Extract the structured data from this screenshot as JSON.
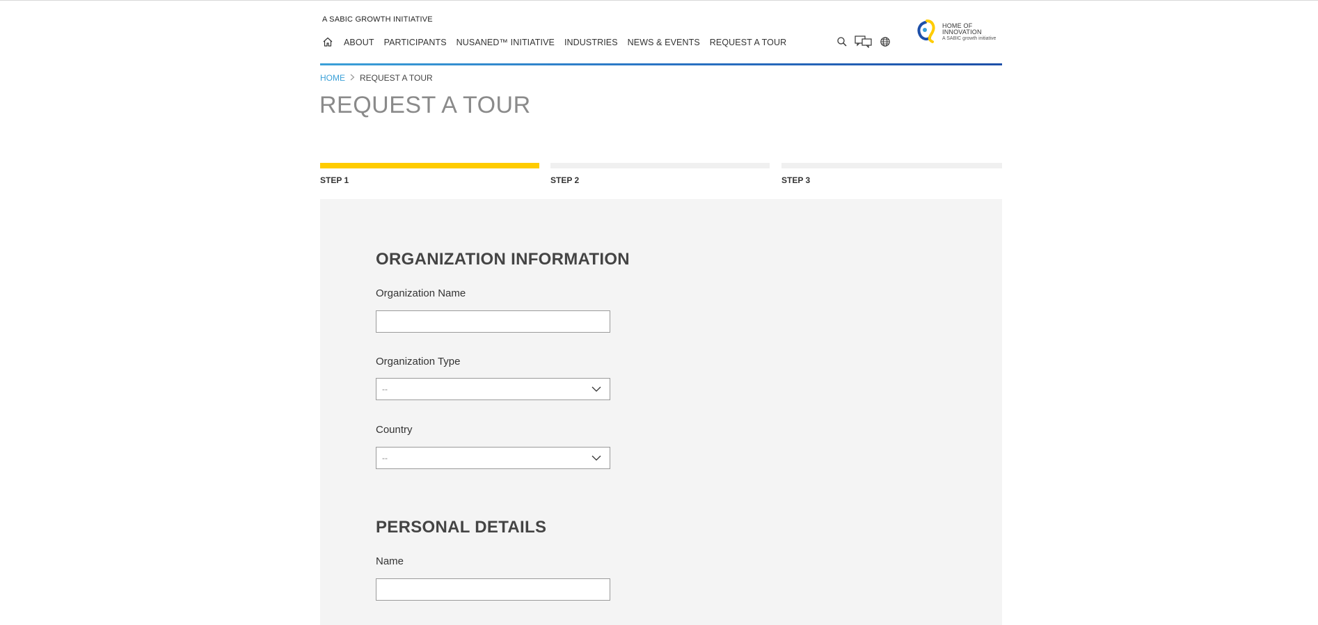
{
  "header": {
    "tagline": "A SABIC GROWTH INITIATIVE",
    "nav": [
      {
        "label": "ABOUT"
      },
      {
        "label": "PARTICIPANTS"
      },
      {
        "label": "NUSANED™ INITIATIVE"
      },
      {
        "label": "INDUSTRIES"
      },
      {
        "label": "NEWS & EVENTS"
      },
      {
        "label": "REQUEST A TOUR"
      }
    ],
    "icons": [
      "home-icon",
      "search-icon",
      "chat-icon",
      "globe-icon"
    ],
    "logo": {
      "line1": "HOME OF",
      "line2": "INNOVATION",
      "line3": "A SABIC growth initiative",
      "colors": {
        "blue": "#1d4fa8",
        "yellow": "#ffcc00"
      }
    },
    "rule_color": "#2a74c4"
  },
  "breadcrumb": {
    "home": "HOME",
    "current": "REQUEST A TOUR"
  },
  "page": {
    "title": "REQUEST A TOUR"
  },
  "steps": [
    {
      "label": "STEP 1",
      "active": true
    },
    {
      "label": "STEP 2",
      "active": false
    },
    {
      "label": "STEP 3",
      "active": false
    }
  ],
  "accent_color": "#ffcc00",
  "form": {
    "organization": {
      "title": "ORGANIZATION INFORMATION",
      "name_label": "Organization Name",
      "name_value": "",
      "type_label": "Organization Type",
      "type_value": "--",
      "country_label": "Country",
      "country_value": "--"
    },
    "personal": {
      "title": "PERSONAL DETAILS",
      "name_label": "Name",
      "name_value": ""
    }
  }
}
